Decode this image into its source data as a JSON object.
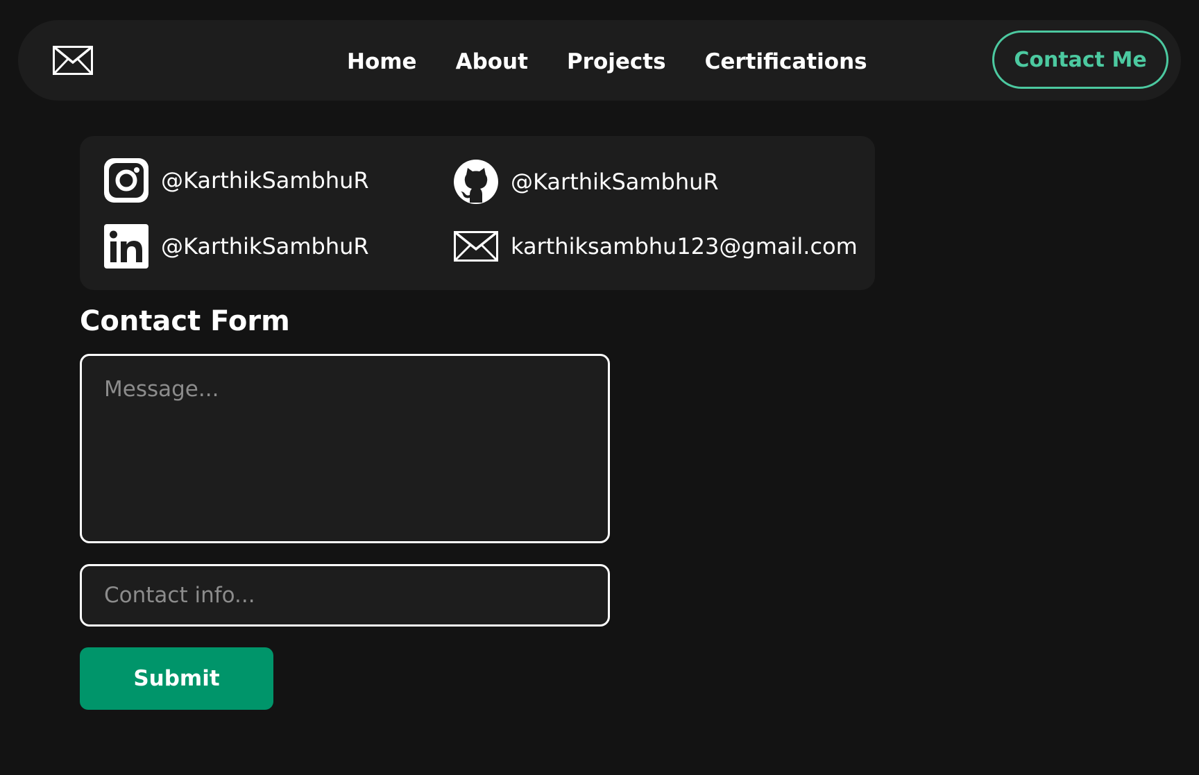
{
  "header": {
    "logo_icon": "envelope-icon",
    "nav": {
      "home": "Home",
      "about": "About",
      "projects": "Projects",
      "certifications": "Certifications"
    },
    "contact_button": "Contact Me"
  },
  "socials": {
    "instagram": {
      "icon": "instagram-icon",
      "handle": "@KarthikSambhuR"
    },
    "github": {
      "icon": "github-icon",
      "handle": "@KarthikSambhuR"
    },
    "linkedin": {
      "icon": "linkedin-icon",
      "handle": "@KarthikSambhuR"
    },
    "email": {
      "icon": "envelope-icon",
      "address": "karthiksambhu123@gmail.com"
    }
  },
  "contact_form": {
    "title": "Contact Form",
    "message_placeholder": "Message...",
    "contact_placeholder": "Contact info...",
    "submit_label": "Submit"
  },
  "colors": {
    "background": "#131313",
    "surface": "#1d1d1d",
    "accent": "#4cc9a0",
    "submit": "#00956a"
  }
}
